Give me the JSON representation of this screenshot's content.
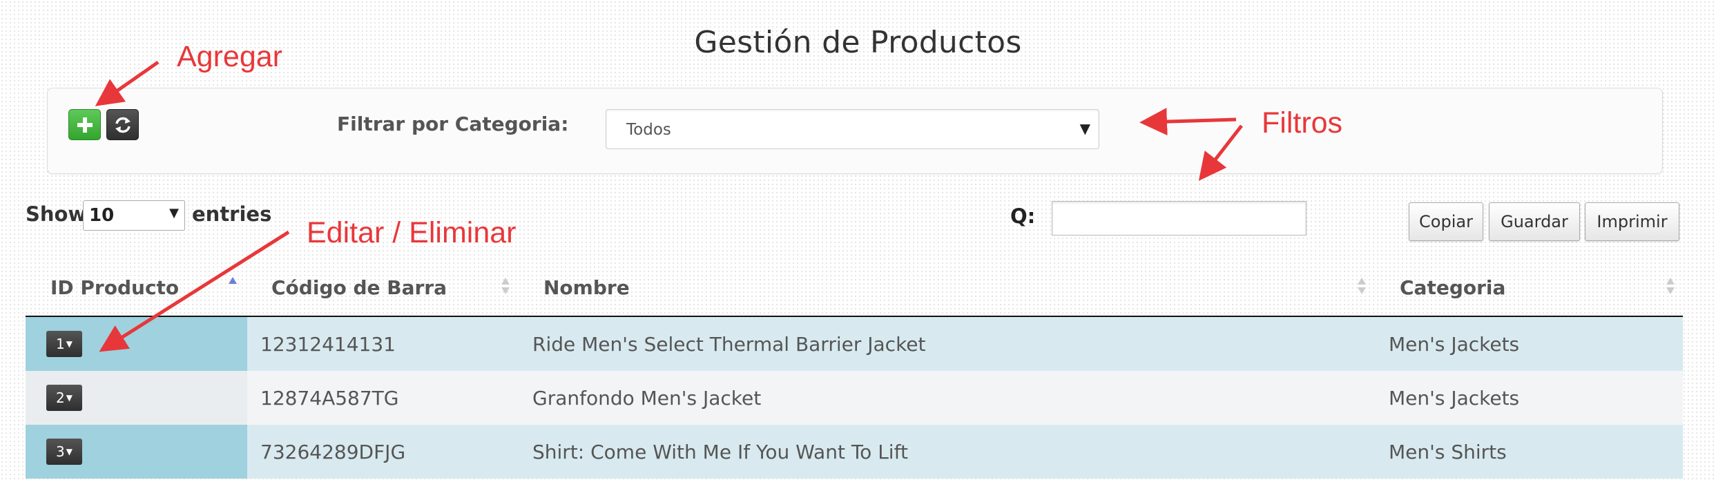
{
  "page": {
    "title": "Gestión de Productos"
  },
  "toolbar": {
    "add_icon": "plus-icon",
    "refresh_icon": "refresh-icon"
  },
  "filter": {
    "label": "Filtrar por Categoria:",
    "selected": "Todos"
  },
  "table_controls": {
    "show": "Show",
    "entries_value": "10",
    "entries": "entries",
    "search_label": "Q:",
    "search_value": ""
  },
  "export": {
    "copy": "Copiar",
    "save": "Guardar",
    "print": "Imprimir"
  },
  "table": {
    "headers": [
      "ID Producto",
      "Código de Barra",
      "Nombre",
      "Categoria"
    ],
    "rows": [
      {
        "id": "1",
        "barcode": "12312414131",
        "name": "Ride Men's Select Thermal Barrier Jacket",
        "category": "Men's Jackets"
      },
      {
        "id": "2",
        "barcode": "12874A587TG",
        "name": "Granfondo Men's Jacket",
        "category": "Men's Jackets"
      },
      {
        "id": "3",
        "barcode": "73264289DFJG",
        "name": "Shirt: Come With Me If You Want To Lift",
        "category": "Men's Shirts"
      }
    ]
  },
  "annotations": {
    "add": "Agregar",
    "filters": "Filtros",
    "edit_delete": "Editar / Eliminar"
  },
  "colors": {
    "annotation": "#e8373a",
    "add_button": "#3bad37",
    "row_highlight": "#9fd1de"
  }
}
